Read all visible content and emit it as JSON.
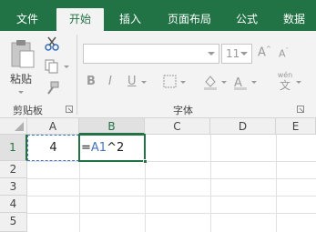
{
  "tabs": [
    {
      "label": "文件",
      "active": false
    },
    {
      "label": "开始",
      "active": true
    },
    {
      "label": "插入",
      "active": false
    },
    {
      "label": "页面布局",
      "active": false
    },
    {
      "label": "公式",
      "active": false
    },
    {
      "label": "数据",
      "active": false
    }
  ],
  "ribbon": {
    "clipboard": {
      "paste_label": "粘贴",
      "group_label": "剪贴板"
    },
    "font": {
      "font_name": "",
      "font_size": "11",
      "bold": "B",
      "italic": "I",
      "underline": "U",
      "wen": "wén",
      "wen_char": "文",
      "group_label": "字体"
    }
  },
  "grid": {
    "corner": "",
    "columns": [
      "A",
      "B",
      "C",
      "D",
      "E"
    ],
    "selected_column": "B",
    "rows": [
      "1",
      "2",
      "3",
      "4",
      "5"
    ],
    "selected_row": "1",
    "cells": {
      "A1": "4",
      "B1_prefix": "=",
      "B1_ref": "A1",
      "B1_suffix": "^2"
    }
  },
  "colors": {
    "accent": "#217346",
    "reference": "#4472c4"
  }
}
